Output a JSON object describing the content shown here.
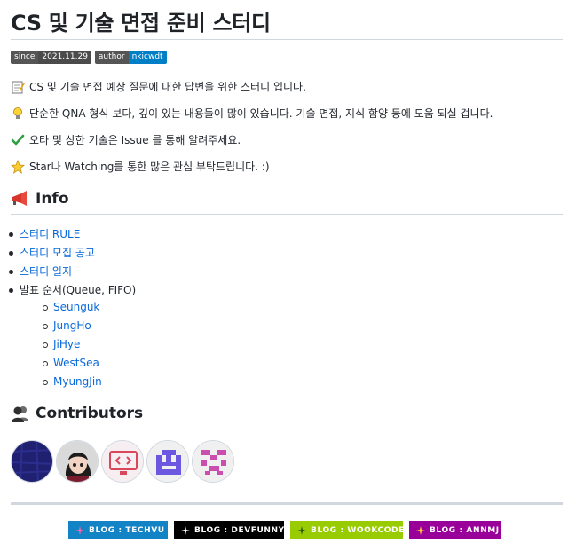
{
  "title": "CS 및 기술 면접 준비 스터디",
  "badges": [
    {
      "key": "since",
      "value": "2021.11.29",
      "color": "#4b4b4b"
    },
    {
      "key": "author",
      "value": "nkicwdt",
      "color": "#007ec6"
    }
  ],
  "intro": [
    {
      "icon": "memo-icon",
      "text": "CS 및 기술 면접 예상 질문에 대한 답변을 위한 스터디 입니다."
    },
    {
      "icon": "lightbulb-icon",
      "text": "단순한 QNA 형식 보다, 깊이 있는 내용들이 많이 있습니다. 기술 면접, 지식 함양 등에 도움 되실 겁니다."
    },
    {
      "icon": "check-mark-icon",
      "text": "오타 및 상한 기술은 Issue 를 통해 알려주세요."
    },
    {
      "icon": "star-icon",
      "text": "Star나 Watching를 통한 많은 관심 부탁드립니다. :)"
    }
  ],
  "info": {
    "heading": "Info",
    "icon": "megaphone-icon",
    "links": [
      "스터디 RULE",
      "스터디 모집 공고",
      "스터디 일지"
    ],
    "order_label": "발표 순서(Queue, FIFO)",
    "order": [
      "Seunguk",
      "JungHo",
      "JiHye",
      "WestSea",
      "MyungJin"
    ]
  },
  "contributors": {
    "heading": "Contributors",
    "icon": "people-icon"
  },
  "blogs": [
    {
      "label": "BLOG : TECHVU",
      "color": "#1283c4"
    },
    {
      "label": "BLOG : DEVFUNNY",
      "color": "#000000"
    },
    {
      "label": "BLOG : WOOKCODE",
      "color": "#99cc00"
    },
    {
      "label": "BLOG : ANNMJ",
      "color": "#990099"
    }
  ],
  "colors": {
    "link": "#0969da",
    "text": "#24292f",
    "rule": "#d0d7de"
  }
}
